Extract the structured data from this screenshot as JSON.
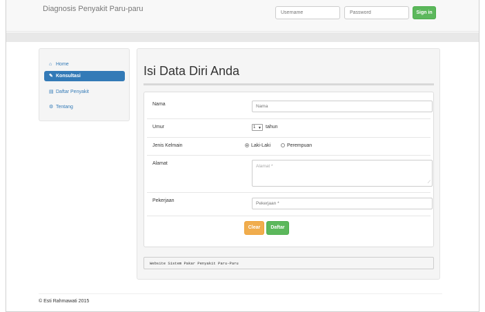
{
  "navbar": {
    "brand": "Diagnosis Penyakit Paru-paru",
    "username_placeholder": "Username",
    "password_placeholder": "Password",
    "signin_label": "Sign in"
  },
  "sidebar": {
    "items": [
      {
        "icon": "home-icon",
        "label": "Home"
      },
      {
        "icon": "pencil-icon",
        "label": "Konsultasi",
        "active": true
      },
      {
        "icon": "book-icon",
        "label": "Daftar Penyakit"
      },
      {
        "icon": "cogs-icon",
        "label": "Tentang"
      }
    ]
  },
  "main": {
    "title": "Isi Data Diri Anda",
    "form": {
      "nama_label": "Nama",
      "nama_placeholder": "Nama",
      "umur_label": "Umur",
      "umur_value": "1",
      "umur_unit": "tahun",
      "jk_label": "Jenis Kelmain",
      "jk_options": [
        "Laki-Laki",
        "Perempuan"
      ],
      "jk_selected": "Laki-Laki",
      "alamat_label": "Alamat",
      "alamat_placeholder": "Alamat *",
      "pekerjaan_label": "Pekerjaan",
      "pekerjaan_placeholder": "Pekerjaan *",
      "clear_label": "Clear",
      "daftar_label": "Daftar"
    },
    "footer_note": "Website Sistem Pakar Penyakit Paru-Paru"
  },
  "footer": {
    "copyright": "© Esti Rahmawati 2015"
  },
  "colors": {
    "primary": "#337ab7",
    "success": "#5cb85c",
    "warning": "#f0ad4e"
  }
}
